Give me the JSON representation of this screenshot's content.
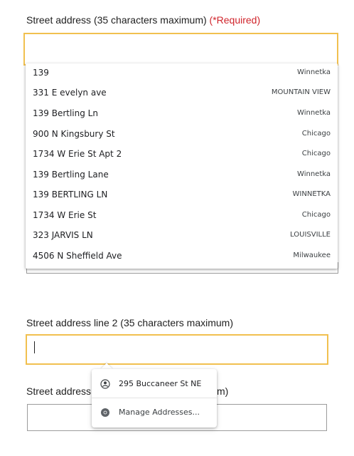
{
  "field1": {
    "label": "Street address (35 characters maximum)",
    "required": "(*Required)",
    "value": ""
  },
  "autocomplete": [
    {
      "address": "139",
      "city": "Winnetka"
    },
    {
      "address": "331 E evelyn ave",
      "city": "MOUNTAIN VIEW"
    },
    {
      "address": "139 Bertling Ln",
      "city": "Winnetka"
    },
    {
      "address": "900 N Kingsbury St",
      "city": "Chicago"
    },
    {
      "address": "1734 W Erie St Apt 2",
      "city": "Chicago"
    },
    {
      "address": "139 Bertling Lane",
      "city": "Winnetka"
    },
    {
      "address": "139 BERTLING LN",
      "city": "WINNETKA"
    },
    {
      "address": "1734 W Erie St",
      "city": "Chicago"
    },
    {
      "address": "323 JARVIS LN",
      "city": "LOUISVILLE"
    },
    {
      "address": "4506 N Sheffield Ave",
      "city": "Milwaukee"
    }
  ],
  "field2": {
    "label": "Street address line 2 (35 characters maximum)",
    "value": ""
  },
  "field3": {
    "label_left": "Street address",
    "label_right": "m)",
    "value": ""
  },
  "chrome_popup": {
    "saved_address": "295 Buccaneer St NE",
    "saved_address_icon": "person-circle-icon",
    "manage_label": "Manage Addresses...",
    "manage_icon": "chrome-icon"
  },
  "colors": {
    "required": "#d0242b",
    "focus_border": "#f1c04f"
  }
}
